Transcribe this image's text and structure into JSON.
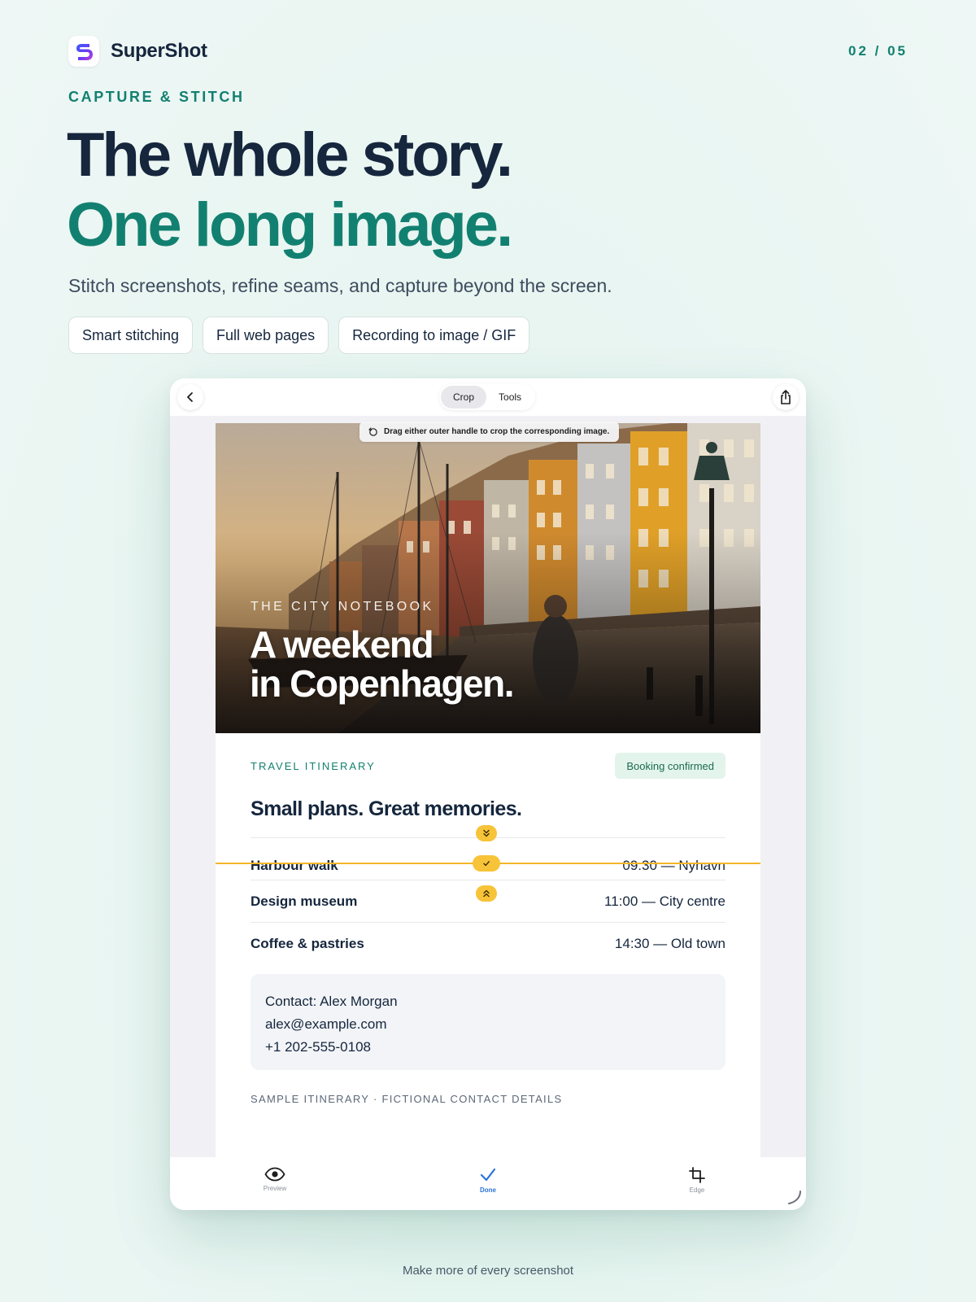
{
  "brand": {
    "name": "SuperShot",
    "logo_icon": "supershot-logo-icon",
    "accent": "#128070",
    "dark": "#15263d"
  },
  "page_counter": "02 / 05",
  "eyebrow": "CAPTURE & STITCH",
  "headline": {
    "line1": "The whole story.",
    "line2": "One long image."
  },
  "subtitle": "Stitch screenshots, refine seams, and capture beyond the screen.",
  "features": [
    "Smart stitching",
    "Full web pages",
    "Recording to image / GIF"
  ],
  "editor": {
    "segments": [
      {
        "label": "Crop",
        "active": true
      },
      {
        "label": "Tools",
        "active": false
      }
    ],
    "tip": "Drag either outer handle to crop the corresponding image.",
    "seam_color": "#f3b629",
    "bottom_tabs": [
      {
        "label": "Preview",
        "icon": "eye-icon",
        "active": false
      },
      {
        "label": "Done",
        "icon": "checkmark-icon",
        "active": true
      },
      {
        "label": "Edge",
        "icon": "crop-icon",
        "active": false
      }
    ]
  },
  "article": {
    "kicker": "THE CITY NOTEBOOK",
    "title_line1": "A weekend",
    "title_line2": "in Copenhagen.",
    "section_label": "TRAVEL ITINERARY",
    "badge": "Booking confirmed",
    "heading": "Small plans. Great memories.",
    "itinerary": [
      {
        "name": "Harbour walk",
        "when": "09:30 — Nyhavn"
      },
      {
        "name": "Design museum",
        "when": "11:00 — City centre"
      },
      {
        "name": "Coffee & pastries",
        "when": "14:30 — Old town"
      }
    ],
    "contact": [
      "Contact: Alex Morgan",
      "alex@example.com",
      "+1 202-555-0108"
    ],
    "footnote": "SAMPLE ITINERARY · FICTIONAL CONTACT DETAILS"
  },
  "tagline": "Make more of every screenshot"
}
